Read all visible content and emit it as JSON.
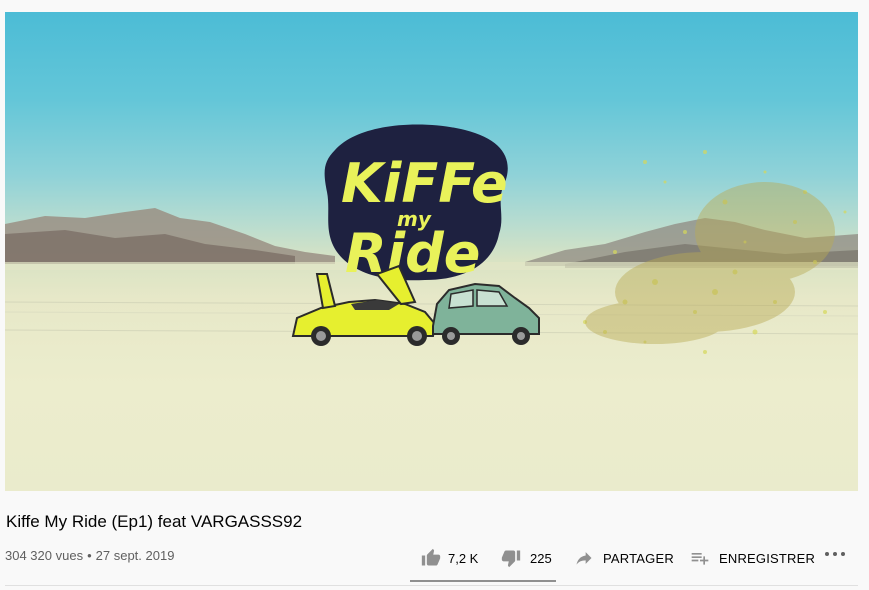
{
  "video": {
    "title": "Kiffe My Ride (Ep1) feat VARGASSS92",
    "views": "304 320 vues",
    "separator": "•",
    "date": "27 sept. 2019",
    "thumbnail_logo": {
      "line1": "KiFFe",
      "line2": "my",
      "line3": "Ride"
    }
  },
  "actions": {
    "like_count": "7,2 K",
    "dislike_count": "225",
    "share_label": "PARTAGER",
    "save_label": "ENREGISTRER",
    "like_ratio": 0.97
  },
  "icons": [
    "thumb-up-icon",
    "thumb-down-icon",
    "share-arrow-icon",
    "playlist-add-icon",
    "more-horizontal-icon"
  ],
  "colors": {
    "text": "#030303",
    "secondary": "#606060",
    "icon": "#909090",
    "logo_yellow": "#e9f25a",
    "logo_navy": "#1e2140"
  }
}
